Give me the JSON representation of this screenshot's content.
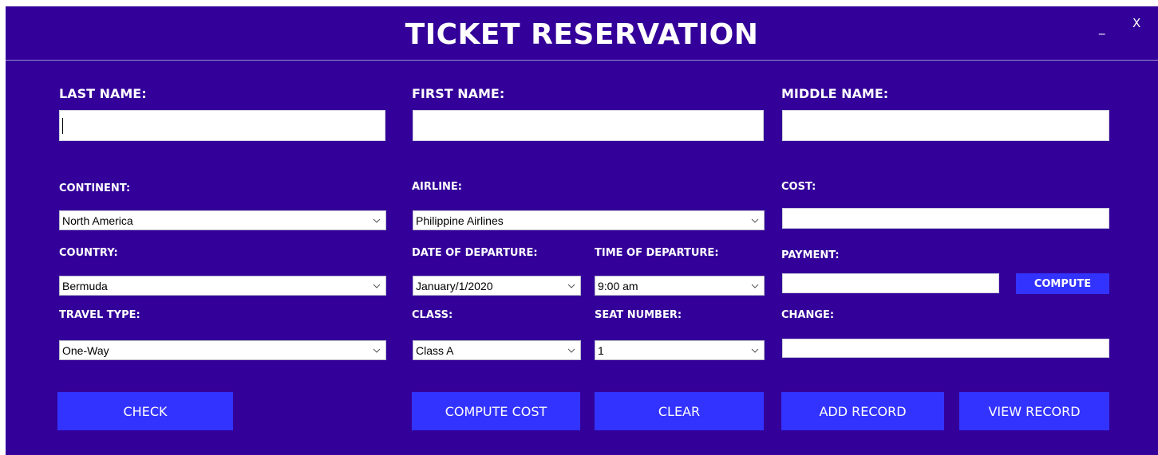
{
  "window": {
    "title": "TICKET RESERVATION",
    "minimize": "_",
    "close": "X"
  },
  "labels": {
    "last_name": "LAST NAME:",
    "first_name": "FIRST NAME:",
    "middle_name": "MIDDLE NAME:",
    "continent": "CONTINENT:",
    "airline": "AIRLINE:",
    "cost": "COST:",
    "country": "COUNTRY:",
    "date_of_departure": "DATE OF DEPARTURE:",
    "time_of_departure": "TIME OF DEPARTURE:",
    "payment": "PAYMENT:",
    "travel_type": "TRAVEL TYPE:",
    "class": "CLASS:",
    "seat_number": "SEAT NUMBER:",
    "change": "CHANGE:"
  },
  "fields": {
    "last_name": "",
    "first_name": "",
    "middle_name": "",
    "cost": "",
    "payment": "",
    "change": ""
  },
  "selects": {
    "continent": "North America",
    "airline": "Philippine Airlines",
    "country": "Bermuda",
    "date_of_departure": "January/1/2020",
    "time_of_departure": "9:00 am",
    "travel_type": "One-Way",
    "class": "Class A",
    "seat_number": "1"
  },
  "buttons": {
    "compute_payment": "COMPUTE",
    "check": "CHECK",
    "compute_cost": "COMPUTE COST",
    "clear": "CLEAR",
    "add_record": "ADD RECORD",
    "view_record": "VIEW RECORD"
  },
  "colors": {
    "window_bg": "#330099",
    "button_bg": "#3333ff",
    "text": "#ffffff"
  },
  "icons": {
    "dropdown": "chevron-down-icon"
  }
}
